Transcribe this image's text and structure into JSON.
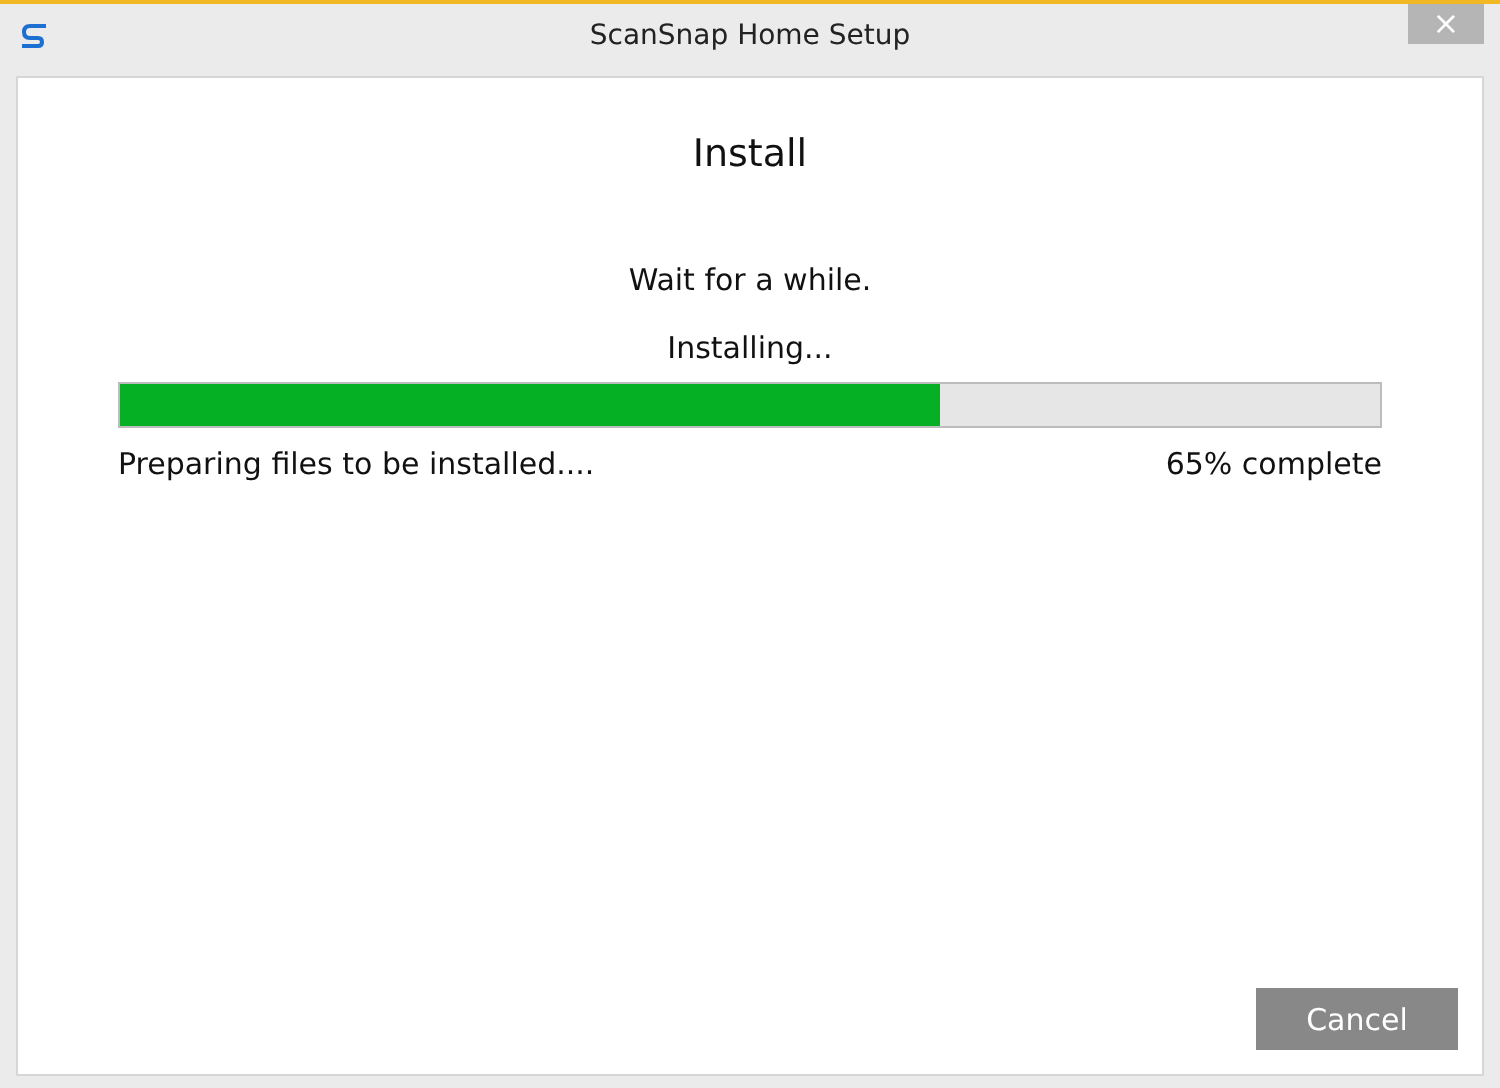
{
  "window": {
    "title": "ScanSnap Home Setup",
    "close": "×"
  },
  "heading": "Install",
  "message": "Wait for a while.",
  "progress": {
    "label": "Installing...",
    "level": 0.65,
    "status": "Preparing files to be installed....",
    "percent": "65% complete"
  },
  "buttons": [
    {
      "label": "Cancel",
      "disabled": false
    }
  ]
}
